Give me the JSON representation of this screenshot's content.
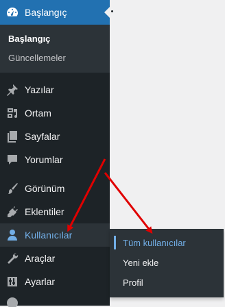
{
  "menu": {
    "dashboard": {
      "label": "Başlangıç",
      "icon": "dashboard-icon"
    },
    "dashboard_sub": [
      {
        "label": "Başlangıç"
      },
      {
        "label": "Güncellemeler"
      }
    ],
    "posts": {
      "label": "Yazılar",
      "icon": "pin-icon"
    },
    "media": {
      "label": "Ortam",
      "icon": "media-icon"
    },
    "pages": {
      "label": "Sayfalar",
      "icon": "pages-icon"
    },
    "comments": {
      "label": "Yorumlar",
      "icon": "comment-icon"
    },
    "appearance": {
      "label": "Görünüm",
      "icon": "brush-icon"
    },
    "plugins": {
      "label": "Eklentiler",
      "icon": "plugin-icon"
    },
    "users": {
      "label": "Kullanıcılar",
      "icon": "user-icon"
    },
    "tools": {
      "label": "Araçlar",
      "icon": "wrench-icon"
    },
    "settings": {
      "label": "Ayarlar",
      "icon": "settings-icon"
    }
  },
  "flyout": [
    {
      "label": "Tüm kullanıcılar"
    },
    {
      "label": "Yeni ekle"
    },
    {
      "label": "Profil"
    }
  ],
  "colors": {
    "sidebar": "#1d2327",
    "accent": "#2271b1",
    "arrow": "#e00000",
    "hover_text": "#72aee6"
  }
}
